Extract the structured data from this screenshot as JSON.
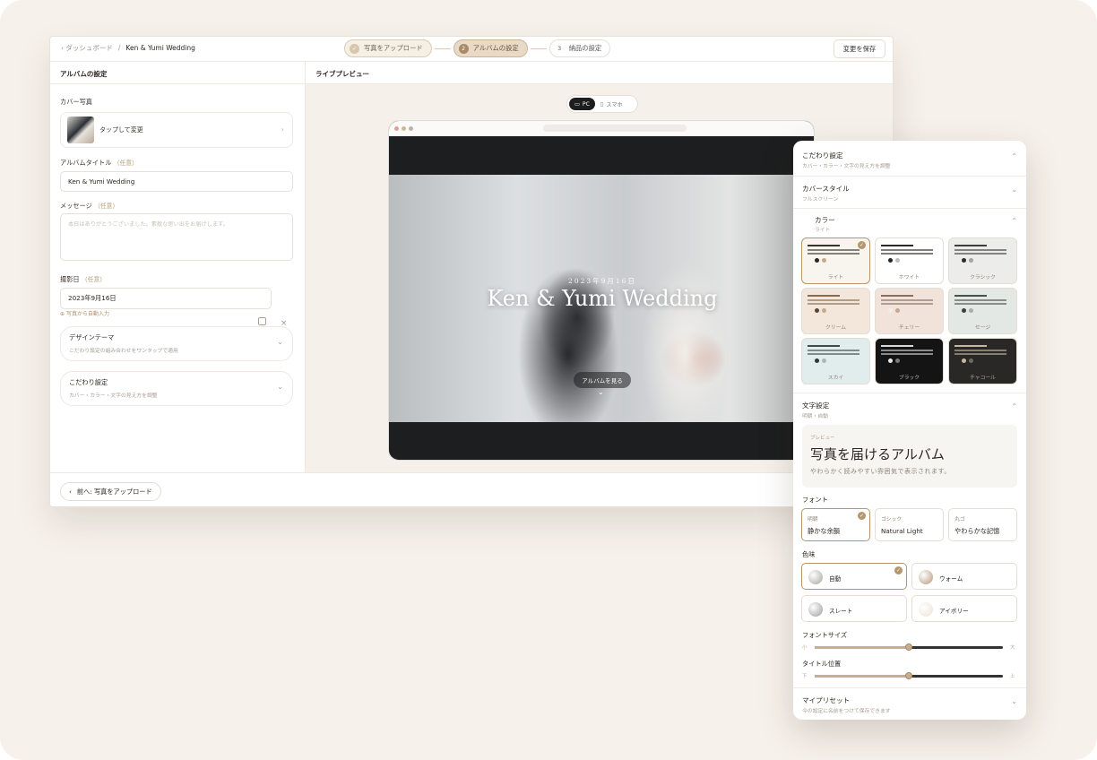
{
  "header": {
    "back_link": "‹ ダッシュボード",
    "album_name": "Ken & Yumi Wedding",
    "steps": [
      {
        "num": "✓",
        "label": "写真をアップロード",
        "state": "done"
      },
      {
        "num": "2",
        "label": "アルバムの設定",
        "state": "active"
      },
      {
        "num": "3",
        "label": "納品の設定",
        "state": "pending"
      }
    ],
    "save_label": "変更を保存"
  },
  "left": {
    "title": "アルバムの設定",
    "cover_label": "カバー写真",
    "cover_action": "タップして変更",
    "album_title_label": "アルバムタイトル",
    "optional": "（任意）",
    "album_title_value": "Ken & Yumi Wedding",
    "message_label": "メッセージ",
    "message_placeholder": "本日はありがとうございました。素敵な思い出をお届けします。",
    "date_label": "撮影日",
    "date_value": "2023年9月16日",
    "date_hint": "写真から自動入力",
    "design_theme": {
      "title": "デザインテーマ",
      "sub": "こだわり設定の組み合わせをワンタップで適用"
    },
    "custom": {
      "title": "こだわり設定",
      "sub": "カバー・カラー・文字の見え方を調整"
    }
  },
  "preview": {
    "title": "ライブプレビュー",
    "device_pc": "PC",
    "device_sp": "スマホ",
    "hero_date": "2023年9月16日",
    "hero_title": "Ken & Yumi Wedding",
    "hero_button": "アルバムを見る"
  },
  "footer": {
    "back_label": "前へ: 写真をアップロード"
  },
  "panel": {
    "custom": {
      "title": "こだわり設定",
      "sub": "カバー・カラー・文字の見え方を調整"
    },
    "cover_style": {
      "title": "カバースタイル",
      "sub": "フルスクリーン"
    },
    "color": {
      "title": "カラー",
      "sub": "ライト"
    },
    "swatches": [
      {
        "name": "ライト",
        "bg": "#f8f4ee",
        "line": "#3a3430",
        "c1": "#2b2622",
        "c2": "#c6a98a",
        "text": "#8d8479",
        "selected": true
      },
      {
        "name": "ホワイト",
        "bg": "#ffffff",
        "line": "#2b2622",
        "c1": "#2b2622",
        "c2": "#bdbdbd",
        "text": "#8d8479",
        "selected": false
      },
      {
        "name": "クラシック",
        "bg": "#ececea",
        "line": "#3d3d3d",
        "c1": "#2b2b2b",
        "c2": "#a3a3a3",
        "text": "#8d8479",
        "selected": false
      },
      {
        "name": "クリーム",
        "bg": "#f3e6da",
        "line": "#8a6b4f",
        "c1": "#5a4534",
        "c2": "#c6a98a",
        "text": "#8d8479",
        "selected": false
      },
      {
        "name": "チェリー",
        "bg": "#f1e2da",
        "line": "#8c6e5f",
        "c1": "#f4ede8",
        "c2": "#c6a598",
        "text": "#8d8479",
        "selected": false
      },
      {
        "name": "セージ",
        "bg": "#e4e8e5",
        "line": "#49514c",
        "c1": "#3a413d",
        "c2": "#a6aea9",
        "text": "#8d8479",
        "selected": false
      },
      {
        "name": "スカイ",
        "bg": "#e1ecec",
        "line": "#3e4a4b",
        "c1": "#2c3738",
        "c2": "#a8b6b6",
        "text": "#8d8479",
        "selected": false
      },
      {
        "name": "ブラック",
        "bg": "#141414",
        "line": "#d8d8d8",
        "c1": "#e9e9e9",
        "c2": "#7a7a7a",
        "text": "#bdbdbd",
        "selected": false
      },
      {
        "name": "チャコール",
        "bg": "#2a2826",
        "line": "#c6b79f",
        "c1": "#c6b79f",
        "c2": "#6e6a64",
        "text": "#a9a196",
        "selected": false
      }
    ],
    "text_settings": {
      "title": "文字設定",
      "sub": "明朝・自動"
    },
    "text_preview": {
      "label": "プレビュー",
      "title": "写真を届けるアルバム",
      "desc": "やわらかく読みやすい雰囲気で表示されます。"
    },
    "font_label": "フォント",
    "fonts": [
      {
        "kind": "明朝",
        "name": "静かな余韻",
        "selected": true
      },
      {
        "kind": "ゴシック",
        "name": "Natural Light",
        "selected": false
      },
      {
        "kind": "丸ゴ",
        "name": "やわらかな記憶",
        "selected": false
      }
    ],
    "tone_label": "色味",
    "tones": [
      {
        "name": "自動",
        "color": "#a7a39d",
        "selected": true
      },
      {
        "name": "ウォーム",
        "color": "#b59576",
        "selected": false
      },
      {
        "name": "スレート",
        "color": "#9a9b9b",
        "selected": false
      },
      {
        "name": "アイボリー",
        "color": "#ebe2d6",
        "selected": false
      }
    ],
    "font_size": {
      "label": "フォントサイズ",
      "min": "小",
      "max": "大",
      "value": 0.5
    },
    "title_pos": {
      "label": "タイトル位置",
      "min": "下",
      "max": "上",
      "value": 0.5
    },
    "my_preset": {
      "title": "マイプリセット",
      "sub": "今の設定に名前をつけて保存できます"
    }
  }
}
